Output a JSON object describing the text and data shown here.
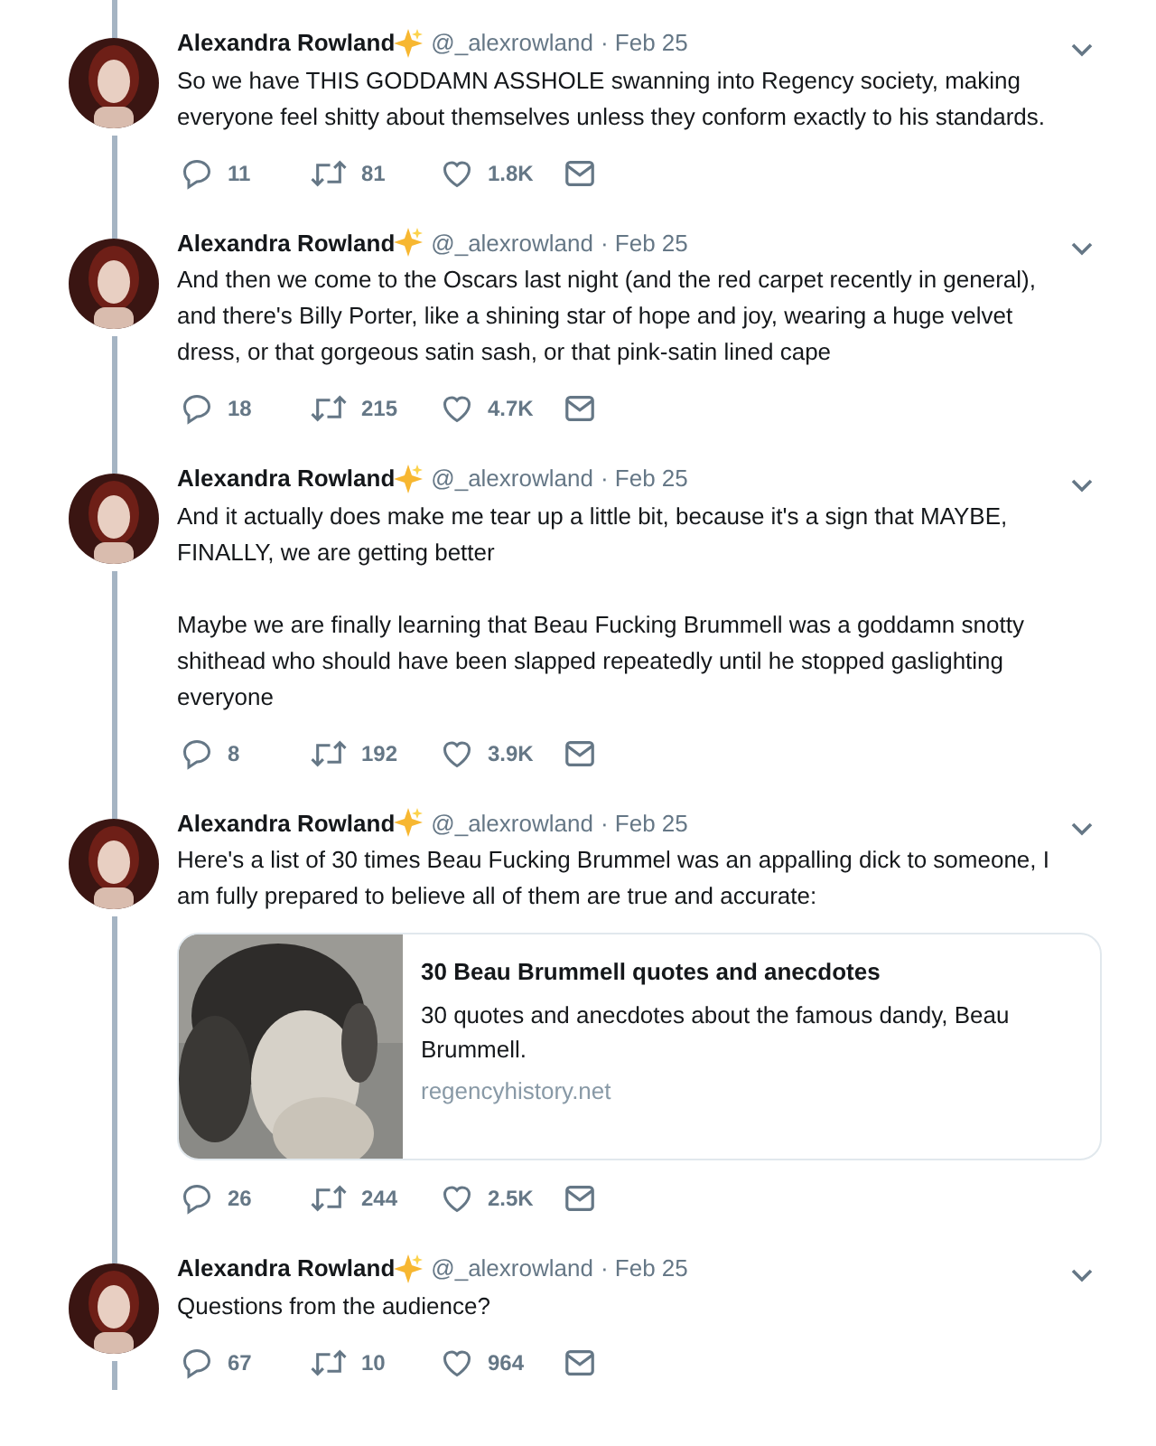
{
  "tweets": [
    {
      "name": "Alexandra Rowland",
      "handle": "@_alexrowland",
      "date": "· Feb 25",
      "paragraphs": [
        "So we have THIS GODDAMN ASSHOLE swanning into Regency society, making everyone feel shitty about themselves unless they conform exactly to his standards."
      ],
      "replies": "11",
      "retweets": "81",
      "likes": "1.8K"
    },
    {
      "name": "Alexandra Rowland",
      "handle": "@_alexrowland",
      "date": "· Feb 25",
      "paragraphs": [
        "And then we come to the Oscars last night (and the red carpet recently in general), and there's Billy Porter, like a shining star of hope and joy, wearing a huge velvet dress, or that gorgeous satin sash, or that pink-satin lined cape"
      ],
      "replies": "18",
      "retweets": "215",
      "likes": "4.7K"
    },
    {
      "name": "Alexandra Rowland",
      "handle": "@_alexrowland",
      "date": "· Feb 25",
      "paragraphs": [
        "And it actually does make me tear up a little bit, because it's a sign that MAYBE, FINALLY, we are getting better",
        "Maybe we are finally learning that Beau Fucking Brummell was a goddamn snotty shithead who should have been slapped repeatedly until he stopped gaslighting everyone"
      ],
      "replies": "8",
      "retweets": "192",
      "likes": "3.9K"
    },
    {
      "name": "Alexandra Rowland",
      "handle": "@_alexrowland",
      "date": "· Feb 25",
      "paragraphs": [
        "Here's a list of 30 times Beau Fucking Brummel was an appalling dick to someone, I am fully prepared to believe all of them are true and accurate:"
      ],
      "card": {
        "kind": "picture",
        "title": "30 Beau Brummell quotes and anecdotes",
        "description": "30 quotes and anecdotes about the famous dandy, Beau Brummell.",
        "domain": "regencyhistory.net"
      },
      "replies": "26",
      "retweets": "244",
      "likes": "2.5K"
    },
    {
      "name": "Alexandra Rowland",
      "handle": "@_alexrowland",
      "date": "· Feb 25",
      "paragraphs": [
        "Questions from the audience?"
      ],
      "replies": "67",
      "retweets": "10",
      "likes": "964"
    }
  ]
}
